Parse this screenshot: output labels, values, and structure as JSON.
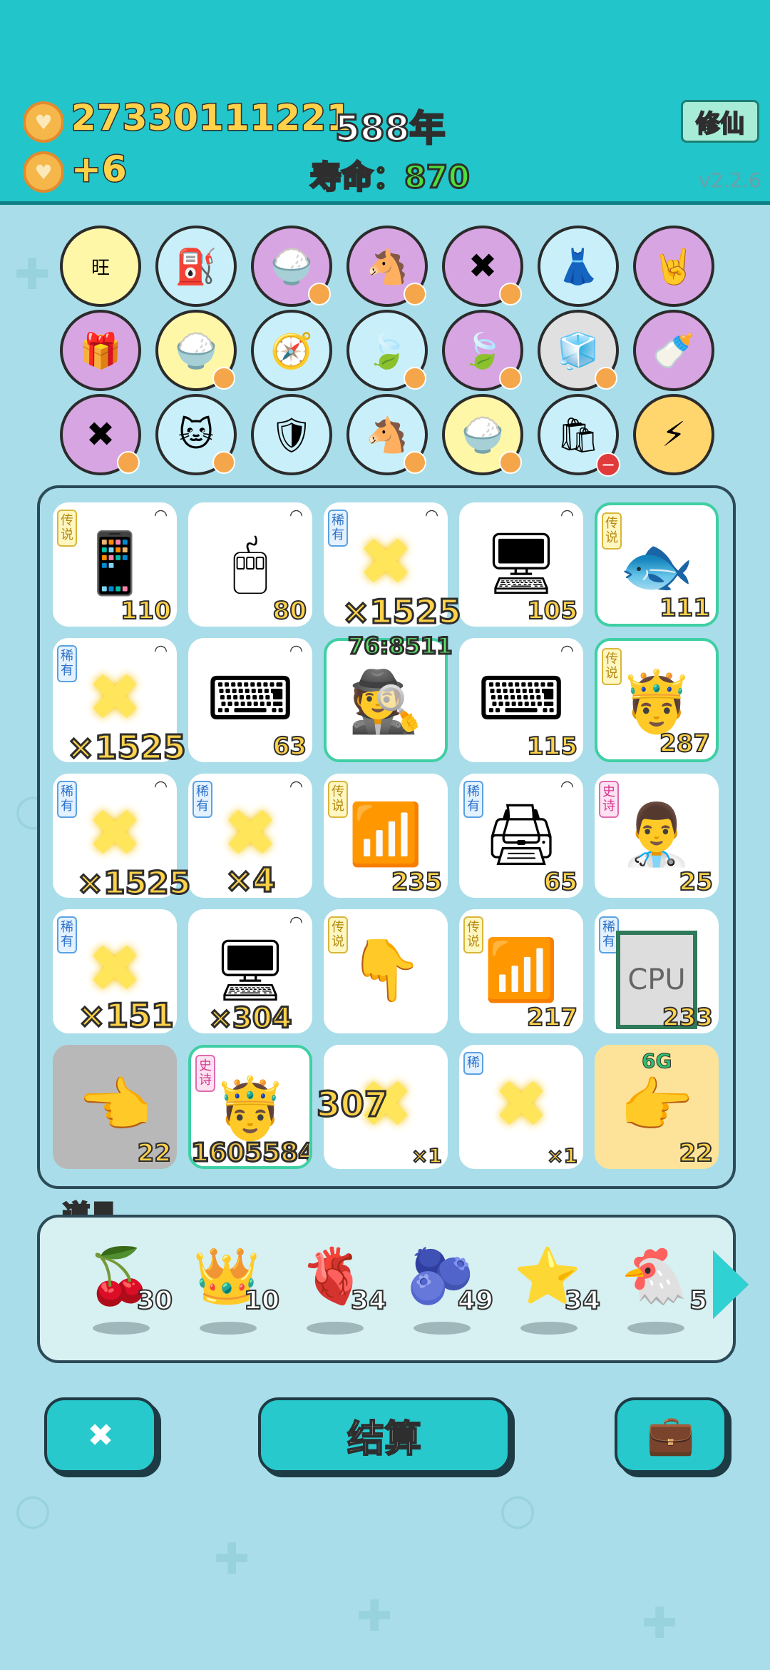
{
  "header": {
    "money": "27330111221",
    "income": "+6",
    "year": "588年",
    "lifespan_label": "寿命：",
    "lifespan_value": "870",
    "xiuxian_button": "修仙",
    "version": "v2.2.6"
  },
  "skills": [
    [
      "wang-dice",
      "air-pump",
      "rice-bowl",
      "two-horses",
      "delete-tag",
      "pleated-skirt",
      "rock-hand"
    ],
    [
      "gift-box",
      "rice-bowl",
      "compass",
      "leaf",
      "leaf",
      "cubes",
      "breast-pump"
    ],
    [
      "delete-tag",
      "cat",
      "shield-wrench",
      "two-horses",
      "rice-bowl",
      "sack",
      "lightning"
    ]
  ],
  "board": {
    "cells": [
      {
        "tag": "传说",
        "icon": "phone",
        "num": "110"
      },
      {
        "tag": "",
        "icon": "mouse",
        "num": "80"
      },
      {
        "tag": "稀有",
        "icon": "server",
        "num": "",
        "big": "×1525"
      },
      {
        "tag": "",
        "icon": "monitor",
        "num": "105"
      },
      {
        "tag": "传说",
        "icon": "fish",
        "num": "111"
      },
      {
        "tag": "稀有",
        "icon": "server",
        "num": "",
        "big": "×1525"
      },
      {
        "tag": "",
        "icon": "keyboard",
        "num": "63"
      },
      {
        "tag": "",
        "icon": "thief",
        "num": "",
        "over": "76:8511"
      },
      {
        "tag": "",
        "icon": "keyboard",
        "num": "115"
      },
      {
        "tag": "传说",
        "icon": "king",
        "num": "287"
      },
      {
        "tag": "稀有",
        "icon": "server",
        "num": "",
        "big": "×1525"
      },
      {
        "tag": "稀有",
        "icon": "server",
        "num": "",
        "big": "×4"
      },
      {
        "tag": "传说",
        "icon": "wifi",
        "num": "235"
      },
      {
        "tag": "稀有",
        "icon": "printer",
        "num": "65"
      },
      {
        "tag": "史诗",
        "icon": "doctor",
        "num": "25"
      },
      {
        "tag": "稀有",
        "icon": "server",
        "num": "",
        "big": "×151"
      },
      {
        "tag": "",
        "icon": "monitor",
        "num": "",
        "big": "×304"
      },
      {
        "tag": "传说",
        "icon": "pointer",
        "num": ""
      },
      {
        "tag": "传说",
        "icon": "wifi",
        "num": "217"
      },
      {
        "tag": "稀有",
        "icon": "cpu",
        "num": "233"
      },
      {
        "tag": "",
        "icon": "pointer",
        "num": "22"
      },
      {
        "tag": "史诗",
        "icon": "king",
        "num": "",
        "big": "1605584"
      },
      {
        "tag": "",
        "icon": "mouse",
        "num": "×1"
      },
      {
        "tag": "稀",
        "icon": "cpu",
        "num": "×1"
      },
      {
        "tag": "",
        "icon": "pointer",
        "num": "22"
      }
    ],
    "floating_307": "307",
    "label_6g": "6G",
    "label_6g_2": "6G"
  },
  "items": {
    "label": "道具",
    "list": [
      {
        "name": "lychee",
        "count": "30"
      },
      {
        "name": "crown",
        "count": "10"
      },
      {
        "name": "liver",
        "count": "34"
      },
      {
        "name": "blueberry",
        "count": "49"
      },
      {
        "name": "star",
        "count": "34"
      },
      {
        "name": "hen",
        "count": "5"
      }
    ]
  },
  "buttons": {
    "settle": "结算"
  },
  "colors": {
    "topbar": "#22c5c9",
    "background": "#a9dde9",
    "gold": "#ffd24a"
  }
}
